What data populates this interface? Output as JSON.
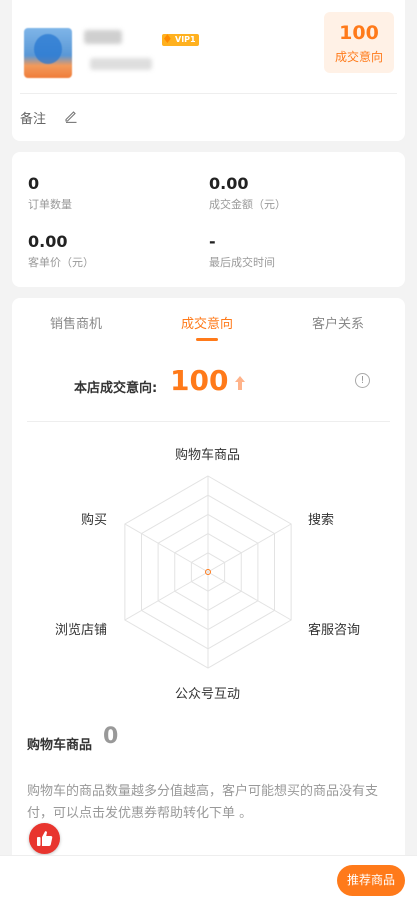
{
  "profile": {
    "vip_badge": "VIP1",
    "intent_score": "100",
    "intent_label": "成交意向",
    "remark_label": "备注"
  },
  "stats": [
    {
      "value": "0",
      "label": "订单数量"
    },
    {
      "value": "0.00",
      "label": "成交金额（元）"
    },
    {
      "value": "0.00",
      "label": "客单价（元）"
    },
    {
      "value": "-",
      "label": "最后成交时间"
    }
  ],
  "tabs": [
    {
      "label": "销售商机",
      "active": false
    },
    {
      "label": "成交意向",
      "active": true
    },
    {
      "label": "客户关系",
      "active": false
    }
  ],
  "intent": {
    "label": "本店成交意向:",
    "value": "100",
    "info_symbol": "!"
  },
  "radar": {
    "axes": [
      "购物车商品",
      "搜索",
      "客服咨询",
      "公众号互动",
      "浏览店铺",
      "购买"
    ],
    "values": [
      0,
      0,
      0,
      0,
      0,
      0
    ],
    "accent_color": "#ff7a1a"
  },
  "detail": {
    "title": "购物车商品",
    "count": "0",
    "description": "购物车的商品数量越多分值越高，客户可能想买的商品没有支付，可以点击发优惠券帮助转化下单 。"
  },
  "bottom": {
    "recommend_label": "推荐商品"
  },
  "colors": {
    "accent": "#ff7a1a",
    "like": "#e8352e",
    "vip": "#ffb11f"
  }
}
